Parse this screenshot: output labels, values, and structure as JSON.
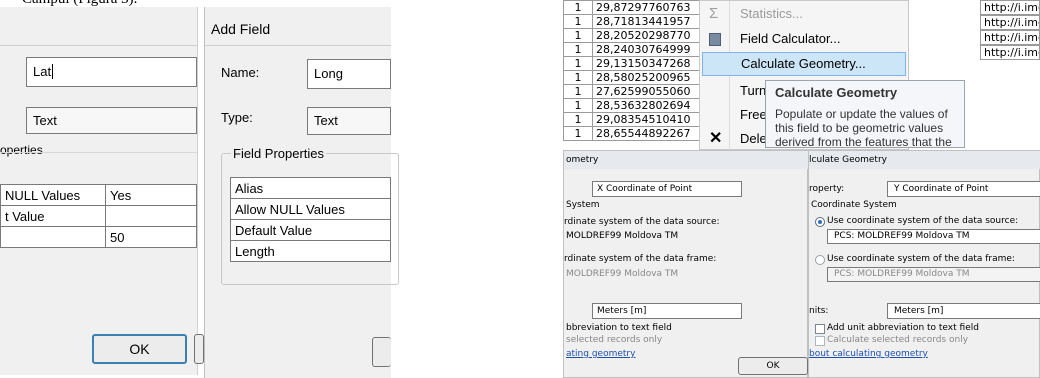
{
  "top_text": "Câmpul (Figura 3).",
  "field_props_left": {
    "name_value": "Lat",
    "type_value": "Text",
    "group_title": "operties",
    "rows": [
      {
        "label": "NULL Values",
        "value": "Yes"
      },
      {
        "label": "t Value",
        "value": ""
      },
      {
        "label": "",
        "value": "50"
      }
    ],
    "ok_label": "OK"
  },
  "add_field": {
    "title": "Add Field",
    "name_label": "Name:",
    "name_value": "Long",
    "type_label": "Type:",
    "type_value": "Text",
    "group_title": "Field Properties",
    "rows": [
      "Alias",
      "Allow NULL Values",
      "Default Value",
      "Length"
    ]
  },
  "attribute_table": {
    "rows": [
      {
        "id": "1",
        "value": "29,87297760763"
      },
      {
        "id": "1",
        "value": "28,71813441957"
      },
      {
        "id": "1",
        "value": "28,20520298770"
      },
      {
        "id": "1",
        "value": "28,24030764999"
      },
      {
        "id": "1",
        "value": "29,13150347268"
      },
      {
        "id": "1",
        "value": "28,58025200965"
      },
      {
        "id": "1",
        "value": "27,62599055060"
      },
      {
        "id": "1",
        "value": "28,53632802694"
      },
      {
        "id": "1",
        "value": "29,08354510410"
      },
      {
        "id": "1",
        "value": "28,65544892267"
      }
    ],
    "url_cells": [
      "http://i.img",
      "http://i.img",
      "http://i.img",
      "http://i.img"
    ]
  },
  "context_menu": {
    "items": [
      {
        "label": "Statistics...",
        "icon": "sigma-icon",
        "disabled": true
      },
      {
        "label": "Field Calculator...",
        "icon": "calculator-icon",
        "disabled": false
      },
      {
        "label": "Calculate Geometry...",
        "icon": "",
        "disabled": false,
        "highlighted": true
      },
      {
        "label": "Turn",
        "icon": "",
        "disabled": false
      },
      {
        "label": "Freez",
        "icon": "",
        "disabled": false
      },
      {
        "label": "Delet",
        "icon": "delete-x-icon",
        "disabled": false
      }
    ]
  },
  "tooltip": {
    "title": "Calculate Geometry",
    "body": "Populate or update the values of this field to be geometric values derived from the features that the"
  },
  "calc_geom_left": {
    "title": "ometry",
    "property_value": "X Coordinate of Point",
    "cs_label": "System",
    "source_label": "rdinate system of the data source:",
    "source_value": "MOLDREF99 Moldova TM",
    "frame_label": "rdinate system of the data frame:",
    "frame_value": "MOLDREF99 Moldova TM",
    "units_value": "Meters [m]",
    "abbrev_label": "bbreviation to text field",
    "selected_label": "selected records only",
    "link_label": "ating geometry",
    "ok_label": "OK"
  },
  "calc_geom_right": {
    "title": "lculate Geometry",
    "property_label": "roperty:",
    "property_value": "Y Coordinate of Point",
    "cs_label": "Coordinate System",
    "source_label": "Use coordinate system of the data source:",
    "source_value": "PCS: MOLDREF99 Moldova TM",
    "frame_label": "Use coordinate system of the data frame:",
    "frame_value": "PCS: MOLDREF99 Moldova TM",
    "units_label": "nits:",
    "units_value": "Meters [m]",
    "abbrev_label": "Add unit abbreviation to text field",
    "selected_label": "Calculate selected records only",
    "link_label": "bout calculating geometry"
  }
}
